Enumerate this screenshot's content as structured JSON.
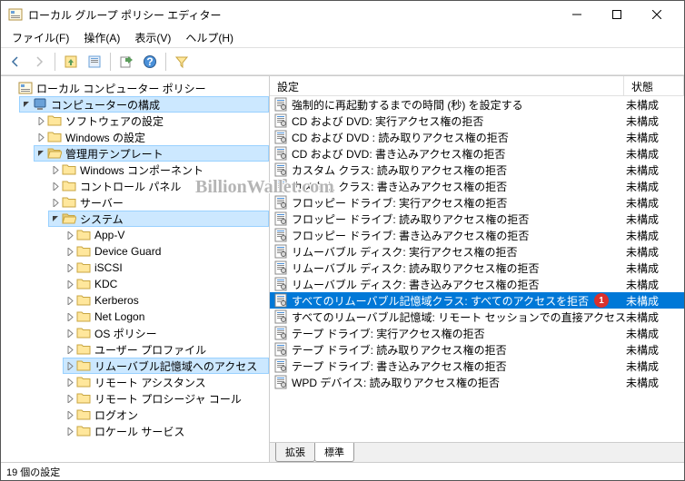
{
  "window": {
    "title": "ローカル グループ ポリシー エディター"
  },
  "menu": {
    "file": "ファイル(F)",
    "action": "操作(A)",
    "view": "表示(V)",
    "help": "ヘルプ(H)"
  },
  "tree": {
    "root": "ローカル コンピューター ポリシー",
    "computer_config": "コンピューターの構成",
    "software": "ソフトウェアの設定",
    "windows_settings": "Windows の設定",
    "admin_templates": "管理用テンプレート",
    "win_components": "Windows コンポーネント",
    "control_panel": "コントロール パネル",
    "server": "サーバー",
    "system": "システム",
    "app_v": "App-V",
    "device_guard": "Device Guard",
    "iscsi": "iSCSI",
    "kdc": "KDC",
    "kerberos": "Kerberos",
    "net_logon": "Net Logon",
    "os_policy": "OS ポリシー",
    "user_profile": "ユーザー プロファイル",
    "removable_storage": "リムーバブル記憶域へのアクセス",
    "remote_assist": "リモート アシスタンス",
    "remote_proc": "リモート プロシージャ コール",
    "logon": "ログオン",
    "locale_services": "ロケール サービス"
  },
  "list": {
    "col_setting": "設定",
    "col_state": "状態",
    "state_notconfig": "未構成",
    "items": [
      "強制的に再起動するまでの時間 (秒) を設定する",
      "CD および DVD: 実行アクセス権の拒否",
      "CD および DVD : 読み取りアクセス権の拒否",
      "CD および DVD: 書き込みアクセス権の拒否",
      "カスタム クラス: 読み取りアクセス権の拒否",
      "カスタム クラス: 書き込みアクセス権の拒否",
      "フロッピー ドライブ: 実行アクセス権の拒否",
      "フロッピー ドライブ: 読み取りアクセス権の拒否",
      "フロッピー ドライブ: 書き込みアクセス権の拒否",
      "リムーバブル ディスク: 実行アクセス権の拒否",
      "リムーバブル ディスク: 読み取りアクセス権の拒否",
      "リムーバブル ディスク: 書き込みアクセス権の拒否",
      "すべてのリムーバブル記憶域クラス: すべてのアクセスを拒否",
      "すべてのリムーバブル記憶域: リモート セッションでの直接アクセスを許...",
      "テープ ドライブ: 実行アクセス権の拒否",
      "テープ ドライブ: 読み取りアクセス権の拒否",
      "テープ ドライブ: 書き込みアクセス権の拒否",
      "WPD デバイス: 読み取りアクセス権の拒否"
    ],
    "selected_index": 12,
    "badge": "1"
  },
  "tabs": {
    "ext": "拡張",
    "std": "標準"
  },
  "status": "19 個の設定",
  "watermark": "BillionWallet.com"
}
